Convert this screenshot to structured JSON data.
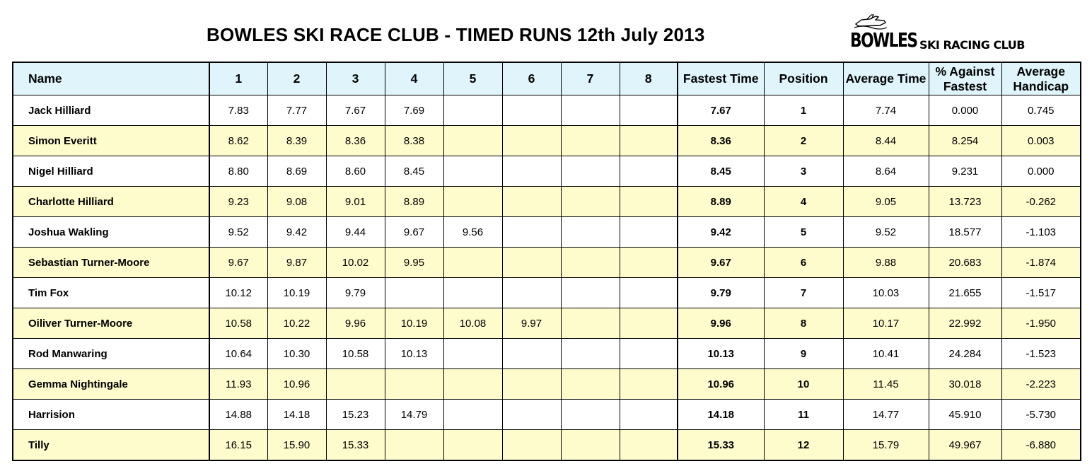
{
  "title": "BOWLES SKI RACE CLUB - TIMED RUNS 12th July 2013",
  "logo": {
    "text_main": "BOWLES",
    "text_sub": "SKI RACING CLUB"
  },
  "table": {
    "headers": [
      "Name",
      "1",
      "2",
      "3",
      "4",
      "5",
      "6",
      "7",
      "8",
      "Fastest Time",
      "Position",
      "Average Time",
      "% Against Fastest",
      "Average Handicap"
    ],
    "rows": [
      {
        "name": "Jack Hilliard",
        "runs": [
          "7.83",
          "7.77",
          "7.67",
          "7.69",
          "",
          "",
          "",
          ""
        ],
        "fastest": "7.67",
        "position": "1",
        "average": "7.74",
        "pct": "0.000",
        "handicap": "0.745"
      },
      {
        "name": "Simon Everitt",
        "runs": [
          "8.62",
          "8.39",
          "8.36",
          "8.38",
          "",
          "",
          "",
          ""
        ],
        "fastest": "8.36",
        "position": "2",
        "average": "8.44",
        "pct": "8.254",
        "handicap": "0.003"
      },
      {
        "name": "Nigel Hilliard",
        "runs": [
          "8.80",
          "8.69",
          "8.60",
          "8.45",
          "",
          "",
          "",
          ""
        ],
        "fastest": "8.45",
        "position": "3",
        "average": "8.64",
        "pct": "9.231",
        "handicap": "0.000"
      },
      {
        "name": "Charlotte Hilliard",
        "runs": [
          "9.23",
          "9.08",
          "9.01",
          "8.89",
          "",
          "",
          "",
          ""
        ],
        "fastest": "8.89",
        "position": "4",
        "average": "9.05",
        "pct": "13.723",
        "handicap": "-0.262"
      },
      {
        "name": "Joshua Wakling",
        "runs": [
          "9.52",
          "9.42",
          "9.44",
          "9.67",
          "9.56",
          "",
          "",
          ""
        ],
        "fastest": "9.42",
        "position": "5",
        "average": "9.52",
        "pct": "18.577",
        "handicap": "-1.103"
      },
      {
        "name": "Sebastian Turner-Moore",
        "runs": [
          "9.67",
          "9.87",
          "10.02",
          "9.95",
          "",
          "",
          "",
          ""
        ],
        "fastest": "9.67",
        "position": "6",
        "average": "9.88",
        "pct": "20.683",
        "handicap": "-1.874"
      },
      {
        "name": "Tim Fox",
        "runs": [
          "10.12",
          "10.19",
          "9.79",
          "",
          "",
          "",
          "",
          ""
        ],
        "fastest": "9.79",
        "position": "7",
        "average": "10.03",
        "pct": "21.655",
        "handicap": "-1.517"
      },
      {
        "name": "Oiliver Turner-Moore",
        "runs": [
          "10.58",
          "10.22",
          "9.96",
          "10.19",
          "10.08",
          "9.97",
          "",
          ""
        ],
        "fastest": "9.96",
        "position": "8",
        "average": "10.17",
        "pct": "22.992",
        "handicap": "-1.950"
      },
      {
        "name": "Rod Manwaring",
        "runs": [
          "10.64",
          "10.30",
          "10.58",
          "10.13",
          "",
          "",
          "",
          ""
        ],
        "fastest": "10.13",
        "position": "9",
        "average": "10.41",
        "pct": "24.284",
        "handicap": "-1.523"
      },
      {
        "name": "Gemma Nightingale",
        "runs": [
          "11.93",
          "10.96",
          "",
          "",
          "",
          "",
          "",
          ""
        ],
        "fastest": "10.96",
        "position": "10",
        "average": "11.45",
        "pct": "30.018",
        "handicap": "-2.223"
      },
      {
        "name": "Harrision",
        "runs": [
          "14.88",
          "14.18",
          "15.23",
          "14.79",
          "",
          "",
          "",
          ""
        ],
        "fastest": "14.18",
        "position": "11",
        "average": "14.77",
        "pct": "45.910",
        "handicap": "-5.730"
      },
      {
        "name": "Tilly",
        "runs": [
          "16.15",
          "15.90",
          "15.33",
          "",
          "",
          "",
          "",
          ""
        ],
        "fastest": "15.33",
        "position": "12",
        "average": "15.79",
        "pct": "49.967",
        "handicap": "-6.880"
      }
    ]
  },
  "colors": {
    "header_bg": "#dff4fb",
    "alt_row_bg": "#fefbcc",
    "row_bg": "#ffffff",
    "border": "#000000"
  }
}
